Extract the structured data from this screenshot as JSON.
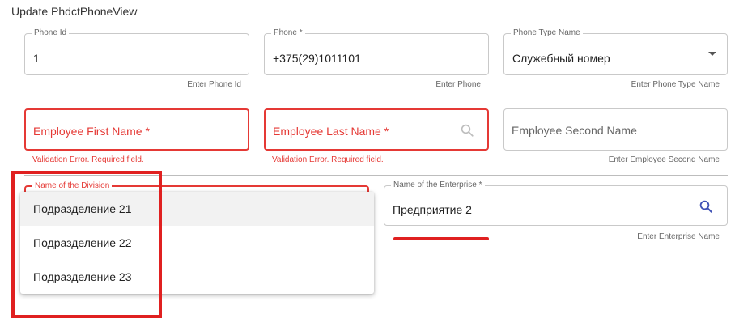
{
  "form": {
    "title": "Update PhdctPhoneView"
  },
  "fields": {
    "phone_id": {
      "label": "Phone Id",
      "value": "1",
      "hint": "Enter Phone Id"
    },
    "phone": {
      "label": "Phone *",
      "value": "+375(29)1011101",
      "hint": "Enter Phone"
    },
    "phone_type": {
      "label": "Phone Type Name",
      "value": "Служебный номер",
      "hint": "Enter Phone Type Name",
      "icon": "chevron-down-icon"
    },
    "first_name": {
      "placeholder": "Employee First Name *",
      "error": "Validation Error. Required field."
    },
    "last_name": {
      "placeholder": "Employee Last Name *",
      "error": "Validation Error. Required field.",
      "icon": "search-icon"
    },
    "second_name": {
      "placeholder": "Employee Second Name",
      "hint": "Enter Employee Second Name"
    },
    "division": {
      "label": "Name of the Division"
    },
    "enterprise": {
      "label": "Name of the Enterprise *",
      "value": "Предприятие 2",
      "hint": "Enter Enterprise Name",
      "icon": "search-icon"
    }
  },
  "division_dropdown": {
    "options": [
      "Подразделение 21",
      "Подразделение 22",
      "Подразделение 23"
    ],
    "highlighted_index": 0
  },
  "annotations": {
    "highlight_color": "#e02020"
  },
  "colors": {
    "error": "#e53935",
    "search_icon_active": "#3f51b5",
    "search_icon_muted": "#bdbdbd"
  }
}
